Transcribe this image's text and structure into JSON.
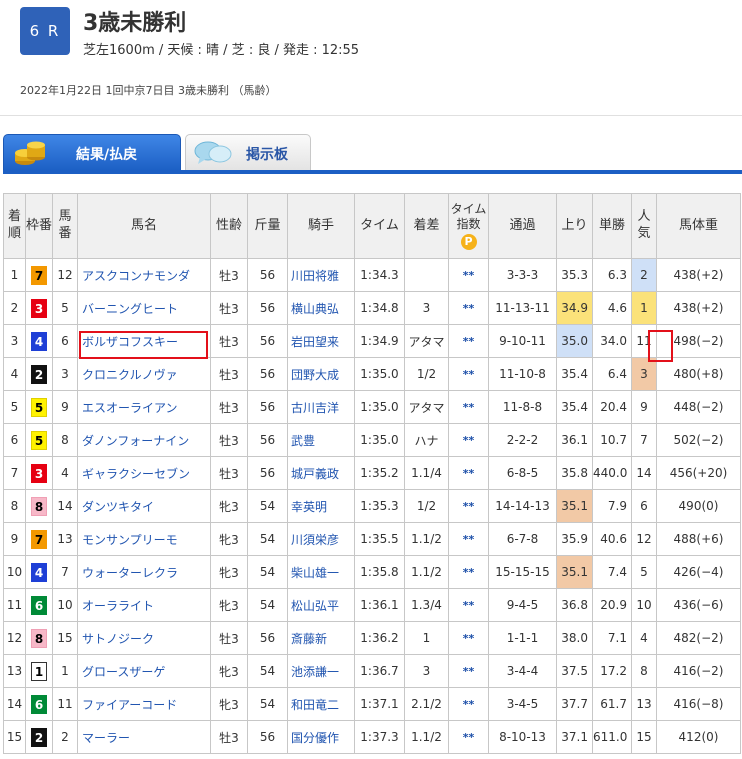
{
  "race": {
    "number": "6 R",
    "title": "3歳未勝利",
    "info": "芝左1600m / 天候 : 晴 / 芝 : 良 / 発走 : 12:55",
    "date_line": "2022年1月22日 1回中京7日目 3歳未勝利 （馬齢）"
  },
  "tabs": {
    "results": "結果/払戻",
    "board": "掲示板"
  },
  "table": {
    "headers": {
      "rank": "着順",
      "waku": "枠番",
      "umaban": "馬番",
      "name": "馬名",
      "sexage": "性齢",
      "weight": "斤量",
      "jockey": "騎手",
      "time": "タイム",
      "margin": "着差",
      "index": "タイム指数",
      "passing": "通過",
      "last3f": "上り",
      "odds": "単勝",
      "pop": "人気",
      "body": "馬体重"
    },
    "index_badge": "P",
    "rows": [
      {
        "rank": "1",
        "waku": "7",
        "umaban": "12",
        "name": "アスクコンナモンダ",
        "sexage": "牡3",
        "weight": "56",
        "jockey": "川田将雅",
        "time": "1:34.3",
        "margin": "",
        "index": "**",
        "passing": "3-3-3",
        "last3f": "35.3",
        "odds": "6.3",
        "pop": "2",
        "body": "438(+2)"
      },
      {
        "rank": "2",
        "waku": "3",
        "umaban": "5",
        "name": "バーニングヒート",
        "sexage": "牡3",
        "weight": "56",
        "jockey": "横山典弘",
        "time": "1:34.8",
        "margin": "3",
        "index": "**",
        "passing": "11-13-11",
        "last3f": "34.9",
        "odds": "4.6",
        "pop": "1",
        "body": "438(+2)"
      },
      {
        "rank": "3",
        "waku": "4",
        "umaban": "6",
        "name": "ボルザコフスキー",
        "sexage": "牡3",
        "weight": "56",
        "jockey": "岩田望来",
        "time": "1:34.9",
        "margin": "アタマ",
        "index": "**",
        "passing": "9-10-11",
        "last3f": "35.0",
        "odds": "34.0",
        "pop": "11",
        "body": "498(−2)"
      },
      {
        "rank": "4",
        "waku": "2",
        "umaban": "3",
        "name": "クロニクルノヴァ",
        "sexage": "牡3",
        "weight": "56",
        "jockey": "団野大成",
        "time": "1:35.0",
        "margin": "1/2",
        "index": "**",
        "passing": "11-10-8",
        "last3f": "35.4",
        "odds": "6.4",
        "pop": "3",
        "body": "480(+8)"
      },
      {
        "rank": "5",
        "waku": "5",
        "umaban": "9",
        "name": "エスオーライアン",
        "sexage": "牡3",
        "weight": "56",
        "jockey": "古川吉洋",
        "time": "1:35.0",
        "margin": "アタマ",
        "index": "**",
        "passing": "11-8-8",
        "last3f": "35.4",
        "odds": "20.4",
        "pop": "9",
        "body": "448(−2)"
      },
      {
        "rank": "6",
        "waku": "5",
        "umaban": "8",
        "name": "ダノンフォーナイン",
        "sexage": "牡3",
        "weight": "56",
        "jockey": "武豊",
        "time": "1:35.0",
        "margin": "ハナ",
        "index": "**",
        "passing": "2-2-2",
        "last3f": "36.1",
        "odds": "10.7",
        "pop": "7",
        "body": "502(−2)"
      },
      {
        "rank": "7",
        "waku": "3",
        "umaban": "4",
        "name": "ギャラクシーセブン",
        "sexage": "牡3",
        "weight": "56",
        "jockey": "城戸義政",
        "time": "1:35.2",
        "margin": "1.1/4",
        "index": "**",
        "passing": "6-8-5",
        "last3f": "35.8",
        "odds": "440.0",
        "pop": "14",
        "body": "456(+20)"
      },
      {
        "rank": "8",
        "waku": "8",
        "umaban": "14",
        "name": "ダンツキタイ",
        "sexage": "牝3",
        "weight": "54",
        "jockey": "幸英明",
        "time": "1:35.3",
        "margin": "1/2",
        "index": "**",
        "passing": "14-14-13",
        "last3f": "35.1",
        "odds": "7.9",
        "pop": "6",
        "body": "490(0)"
      },
      {
        "rank": "9",
        "waku": "7",
        "umaban": "13",
        "name": "モンサンプリーモ",
        "sexage": "牝3",
        "weight": "54",
        "jockey": "川須栄彦",
        "time": "1:35.5",
        "margin": "1.1/2",
        "index": "**",
        "passing": "6-7-8",
        "last3f": "35.9",
        "odds": "40.6",
        "pop": "12",
        "body": "488(+6)"
      },
      {
        "rank": "10",
        "waku": "4",
        "umaban": "7",
        "name": "ウォーターレクラ",
        "sexage": "牝3",
        "weight": "54",
        "jockey": "柴山雄一",
        "time": "1:35.8",
        "margin": "1.1/2",
        "index": "**",
        "passing": "15-15-15",
        "last3f": "35.1",
        "odds": "7.4",
        "pop": "5",
        "body": "426(−4)"
      },
      {
        "rank": "11",
        "waku": "6",
        "umaban": "10",
        "name": "オーラライト",
        "sexage": "牝3",
        "weight": "54",
        "jockey": "松山弘平",
        "time": "1:36.1",
        "margin": "1.3/4",
        "index": "**",
        "passing": "9-4-5",
        "last3f": "36.8",
        "odds": "20.9",
        "pop": "10",
        "body": "436(−6)"
      },
      {
        "rank": "12",
        "waku": "8",
        "umaban": "15",
        "name": "サトノジーク",
        "sexage": "牡3",
        "weight": "56",
        "jockey": "斎藤新",
        "time": "1:36.2",
        "margin": "1",
        "index": "**",
        "passing": "1-1-1",
        "last3f": "38.0",
        "odds": "7.1",
        "pop": "4",
        "body": "482(−2)"
      },
      {
        "rank": "13",
        "waku": "1",
        "umaban": "1",
        "name": "グロースザーゲ",
        "sexage": "牝3",
        "weight": "54",
        "jockey": "池添謙一",
        "time": "1:36.7",
        "margin": "3",
        "index": "**",
        "passing": "3-4-4",
        "last3f": "37.5",
        "odds": "17.2",
        "pop": "8",
        "body": "416(−2)"
      },
      {
        "rank": "14",
        "waku": "6",
        "umaban": "11",
        "name": "ファイアーコード",
        "sexage": "牝3",
        "weight": "54",
        "jockey": "和田竜二",
        "time": "1:37.1",
        "margin": "2.1/2",
        "index": "**",
        "passing": "3-4-5",
        "last3f": "37.7",
        "odds": "61.7",
        "pop": "13",
        "body": "416(−8)"
      },
      {
        "rank": "15",
        "waku": "2",
        "umaban": "2",
        "name": "マーラー",
        "sexage": "牡3",
        "weight": "56",
        "jockey": "国分優作",
        "time": "1:37.3",
        "margin": "1.1/2",
        "index": "**",
        "passing": "8-10-13",
        "last3f": "37.1",
        "odds": "611.0",
        "pop": "15",
        "body": "412(0)"
      }
    ]
  },
  "colors": {
    "race_badge": "#2f62b8",
    "tab_active": "#1c5fc4",
    "link": "#2155b0",
    "highlight_border": "#e3101a",
    "pop_1": "#fbe27a",
    "pop_2": "#cfe0f7",
    "pop_3": "#f2c9a6",
    "last3f_1": "#fbe27a",
    "last3f_2": "#cfe0f7",
    "last3f_3": "#f2c9a6"
  },
  "waku_colors": {
    "1": {
      "bg": "#ffffff",
      "fg": "#000000",
      "border": "#333333"
    },
    "2": {
      "bg": "#111111",
      "fg": "#ffffff",
      "border": "#111111"
    },
    "3": {
      "bg": "#e60012",
      "fg": "#ffffff",
      "border": "#e60012"
    },
    "4": {
      "bg": "#1e3fd6",
      "fg": "#ffffff",
      "border": "#1e3fd6"
    },
    "5": {
      "bg": "#fff200",
      "fg": "#000000",
      "border": "#e0d000"
    },
    "6": {
      "bg": "#008a37",
      "fg": "#ffffff",
      "border": "#008a37"
    },
    "7": {
      "bg": "#f39800",
      "fg": "#000000",
      "border": "#f39800"
    },
    "8": {
      "bg": "#f7b8c8",
      "fg": "#000000",
      "border": "#f0a0b5"
    }
  },
  "icons": {
    "results_tab": "coins-icon",
    "board_tab": "chat-bubbles-icon"
  }
}
